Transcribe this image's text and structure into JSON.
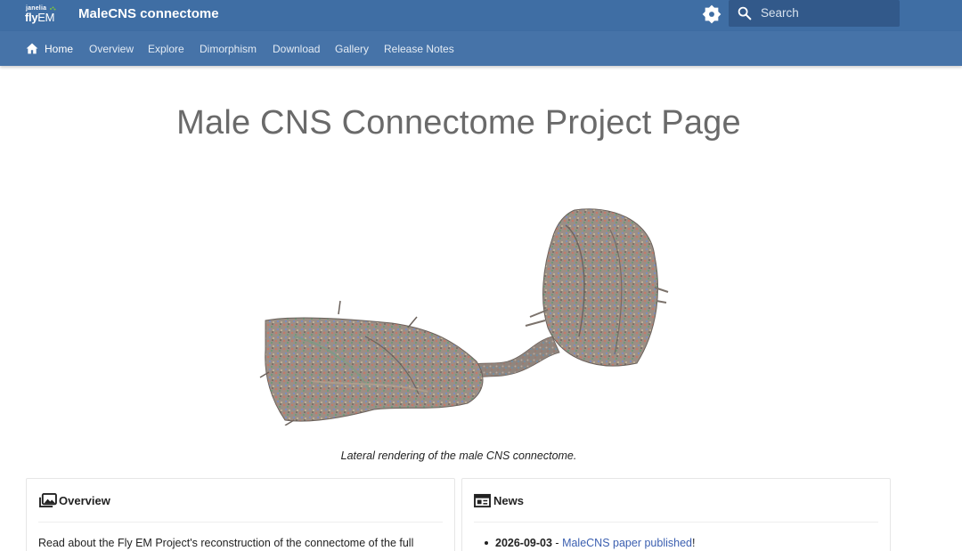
{
  "header": {
    "logo_line1": "janelia",
    "logo_line2_bold": "fly",
    "logo_line2_light": "EM",
    "site_title": "MaleCNS connectome",
    "search_placeholder": "Search",
    "icons": [
      "theme-toggle-icon",
      "search-icon"
    ]
  },
  "tabs": [
    {
      "label": "Home",
      "active": true,
      "icon": "home-icon"
    },
    {
      "label": "Overview",
      "active": false
    },
    {
      "label": "Explore",
      "active": false
    },
    {
      "label": "Dimorphism",
      "active": false
    },
    {
      "label": "Download",
      "active": false
    },
    {
      "label": "Gallery",
      "active": false
    },
    {
      "label": "Release Notes",
      "active": false
    }
  ],
  "main": {
    "title": "Male CNS Connectome Project Page",
    "figure_caption": "Lateral rendering of the male CNS connectome."
  },
  "cards": {
    "overview": {
      "title": "Overview",
      "icon": "image-gallery-icon",
      "text": "Read about the Fly EM Project's reconstruction of the connectome of the full"
    },
    "news": {
      "title": "News",
      "icon": "newspaper-icon",
      "items": [
        {
          "date": "2026-09-03",
          "separator": " - ",
          "link_text": "MaleCNS paper published",
          "suffix": "!"
        }
      ]
    }
  },
  "colors": {
    "header_bg": "#3f6ea4",
    "tabs_bg": "#4673a8",
    "search_bg": "#32598a",
    "link": "#3b5fb0",
    "title_gray": "#6a6a6a"
  }
}
